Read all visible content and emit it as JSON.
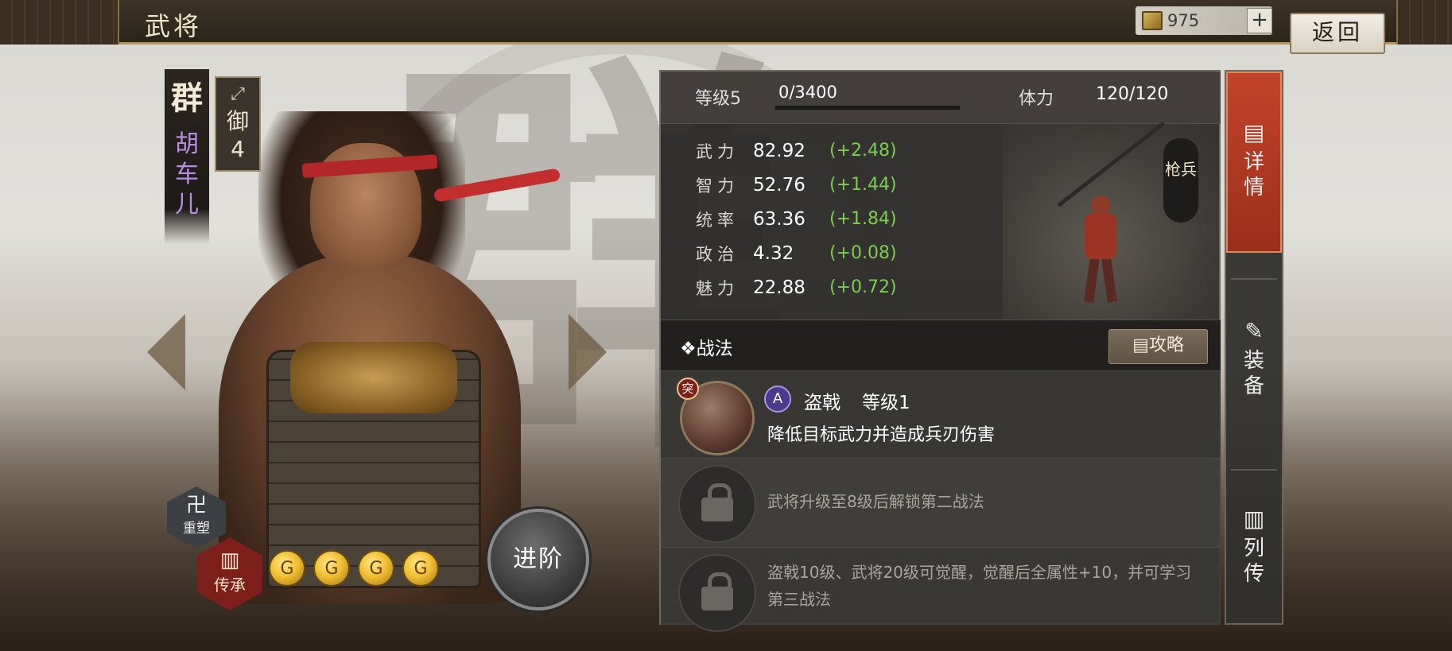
{
  "topbar": {
    "title": "武将"
  },
  "resource": {
    "icon": "jade-coin-icon",
    "value": "975",
    "add_label": "+"
  },
  "back_label": "返回",
  "hero": {
    "faction": "群",
    "name": "胡车儿",
    "cost_arrow": "⤢",
    "cost_label": "御",
    "cost_value": "4",
    "rebuild_label": "重塑",
    "rebuild_icon": "卍",
    "inherit_label": "传承",
    "inherit_icon": "▥",
    "stars": [
      "G",
      "G",
      "G",
      "G"
    ],
    "advance_label": "进阶"
  },
  "level": {
    "label": "等级5",
    "exp": "0/3400",
    "exp_fill": 0.0,
    "stamina_label": "体力",
    "stamina": "120/120"
  },
  "stats": [
    {
      "name": "武力",
      "value": "82.92",
      "delta": "(+2.48)"
    },
    {
      "name": "智力",
      "value": "52.76",
      "delta": "(+1.44)"
    },
    {
      "name": "统率",
      "value": "63.36",
      "delta": "(+1.84)"
    },
    {
      "name": "政治",
      "value": "4.32",
      "delta": "(+0.08)"
    },
    {
      "name": "魅力",
      "value": "22.88",
      "delta": "(+0.72)"
    }
  ],
  "unit_type": "枪兵",
  "skills": {
    "header": "❖战法",
    "guide_label": "▤攻略",
    "slot1": {
      "badge": "突",
      "grade": "A",
      "name": "盗戟",
      "level": "等级1",
      "desc": "降低目标武力并造成兵刃伤害"
    },
    "slot2": {
      "text": "武将升级至8级后解锁第二战法"
    },
    "slot3": {
      "text": "盗戟10级、武将20级可觉醒，觉醒后全属性+10，并可学习第三战法"
    }
  },
  "tabs": [
    {
      "label": "详情",
      "icon": "▤"
    },
    {
      "label": "装备",
      "icon": "✎"
    },
    {
      "label": "列传",
      "icon": "▥"
    }
  ],
  "colors": {
    "accent_red": "#c2432a",
    "stat_delta_green": "#7ccd4f",
    "grade_purple": "#4c3a8c"
  }
}
